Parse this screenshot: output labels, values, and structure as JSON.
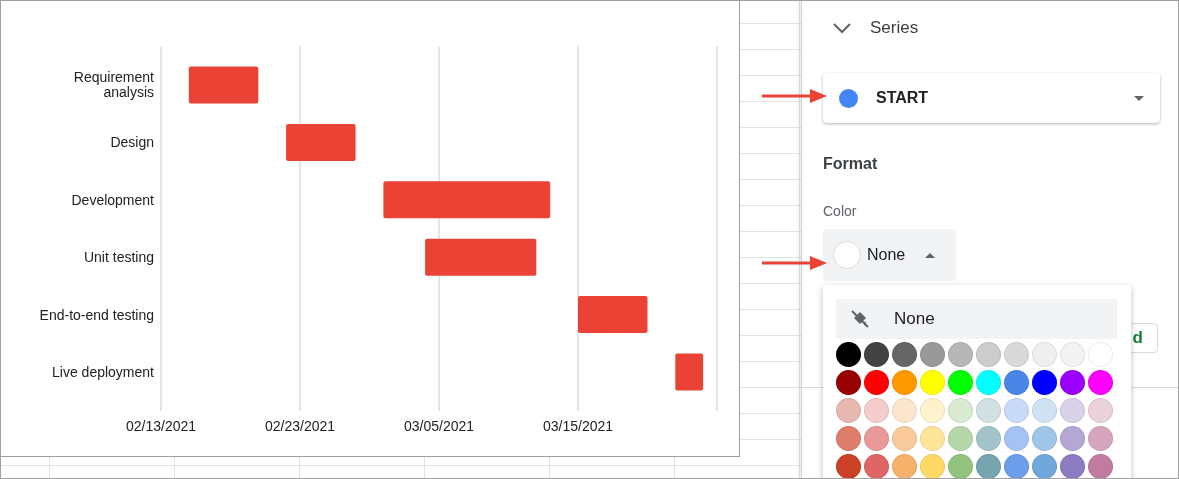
{
  "chart": {
    "task_labels": [
      "Requirement analysis",
      "Design",
      "Development",
      "Unit testing",
      "End-to-end testing",
      "Live deployment"
    ],
    "axis_labels": [
      "02/13/2021",
      "02/23/2021",
      "03/05/2021",
      "03/15/2021"
    ]
  },
  "panel": {
    "section": {
      "title": "Series",
      "expanded": true
    },
    "series_dropdown": {
      "value": "START",
      "color": "#4285f4"
    },
    "format_heading": "Format",
    "color_label": "Color",
    "color_button": {
      "value": "None",
      "open": true
    },
    "hidden_button": {
      "label": "d"
    },
    "color_menu": {
      "none_item": {
        "label": "None",
        "selected": true
      },
      "palette": [
        [
          {
            "color": "#000000"
          },
          {
            "color": "#434343"
          },
          {
            "color": "#666666"
          },
          {
            "color": "#999999"
          },
          {
            "color": "#b7b7b7"
          },
          {
            "color": "#cccccc"
          },
          {
            "color": "#d9d9d9"
          },
          {
            "color": "#efefef"
          },
          {
            "color": "#f3f3f3"
          },
          {
            "color": "#ffffff"
          }
        ],
        [
          {
            "color": "#980000"
          },
          {
            "color": "#ff0000"
          },
          {
            "color": "#ff9900"
          },
          {
            "color": "#ffff00"
          },
          {
            "color": "#00ff00"
          },
          {
            "color": "#00ffff"
          },
          {
            "color": "#4a86e8"
          },
          {
            "color": "#0000ff"
          },
          {
            "color": "#9900ff"
          },
          {
            "color": "#ff00ff"
          }
        ],
        [
          {
            "color": "#e6b8af"
          },
          {
            "color": "#f4cccc"
          },
          {
            "color": "#fce5cd"
          },
          {
            "color": "#fff2cc"
          },
          {
            "color": "#d9ead3"
          },
          {
            "color": "#d0e0e3"
          },
          {
            "color": "#c9daf8"
          },
          {
            "color": "#cfe2f3"
          },
          {
            "color": "#d9d2e9"
          },
          {
            "color": "#ead1dc"
          }
        ],
        [
          {
            "color": "#dd7e6b"
          },
          {
            "color": "#ea9999"
          },
          {
            "color": "#f9cb9c"
          },
          {
            "color": "#ffe599"
          },
          {
            "color": "#b6d7a8"
          },
          {
            "color": "#a2c4c9"
          },
          {
            "color": "#a4c2f4"
          },
          {
            "color": "#9fc5e8"
          },
          {
            "color": "#b4a7d6"
          },
          {
            "color": "#d5a6bd"
          }
        ],
        [
          {
            "color": "#cc4125"
          },
          {
            "color": "#e06666"
          },
          {
            "color": "#f6b26b"
          },
          {
            "color": "#ffd966"
          },
          {
            "color": "#93c47d"
          },
          {
            "color": "#76a5af"
          },
          {
            "color": "#6d9eeb"
          },
          {
            "color": "#6fa8dc"
          },
          {
            "color": "#8e7cc3"
          },
          {
            "color": "#c27ba0"
          }
        ]
      ]
    }
  }
}
